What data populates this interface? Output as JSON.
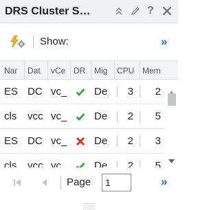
{
  "panel": {
    "title": "DRS Cluster S…",
    "icons": [
      "collapse-icon",
      "edit-icon",
      "help-icon",
      "close-icon"
    ]
  },
  "toolbar": {
    "show_label": "Show:",
    "more_label": "»"
  },
  "grid": {
    "columns": [
      "Nar",
      "Dat",
      "vCe",
      "DR",
      "Mig",
      "CPU",
      "Mem"
    ],
    "rows": [
      {
        "name": "ES",
        "datacenter": "DC",
        "vcenter": "vc_",
        "drs": "enabled",
        "migration": "De",
        "cpu": "3",
        "mem": "2"
      },
      {
        "name": "cls",
        "datacenter": "vcc",
        "vcenter": "vc_",
        "drs": "enabled",
        "migration": "De",
        "cpu": "2",
        "mem": "5"
      },
      {
        "name": "ES",
        "datacenter": "DC",
        "vcenter": "vc_",
        "drs": "disabled",
        "migration": "De",
        "cpu": "2",
        "mem": "3"
      },
      {
        "name": "cls",
        "datacenter": "vcc",
        "vcenter": "vc_",
        "drs": "enabled",
        "migration": "De",
        "cpu": "2",
        "mem": "5"
      }
    ]
  },
  "pager": {
    "page_label": "Page",
    "page_value": "1",
    "more_label": "»"
  },
  "colors": {
    "accent": "#1a6fc9",
    "check": "#3aa537",
    "cross": "#d9342b",
    "header_bg": "#eff0f1"
  }
}
